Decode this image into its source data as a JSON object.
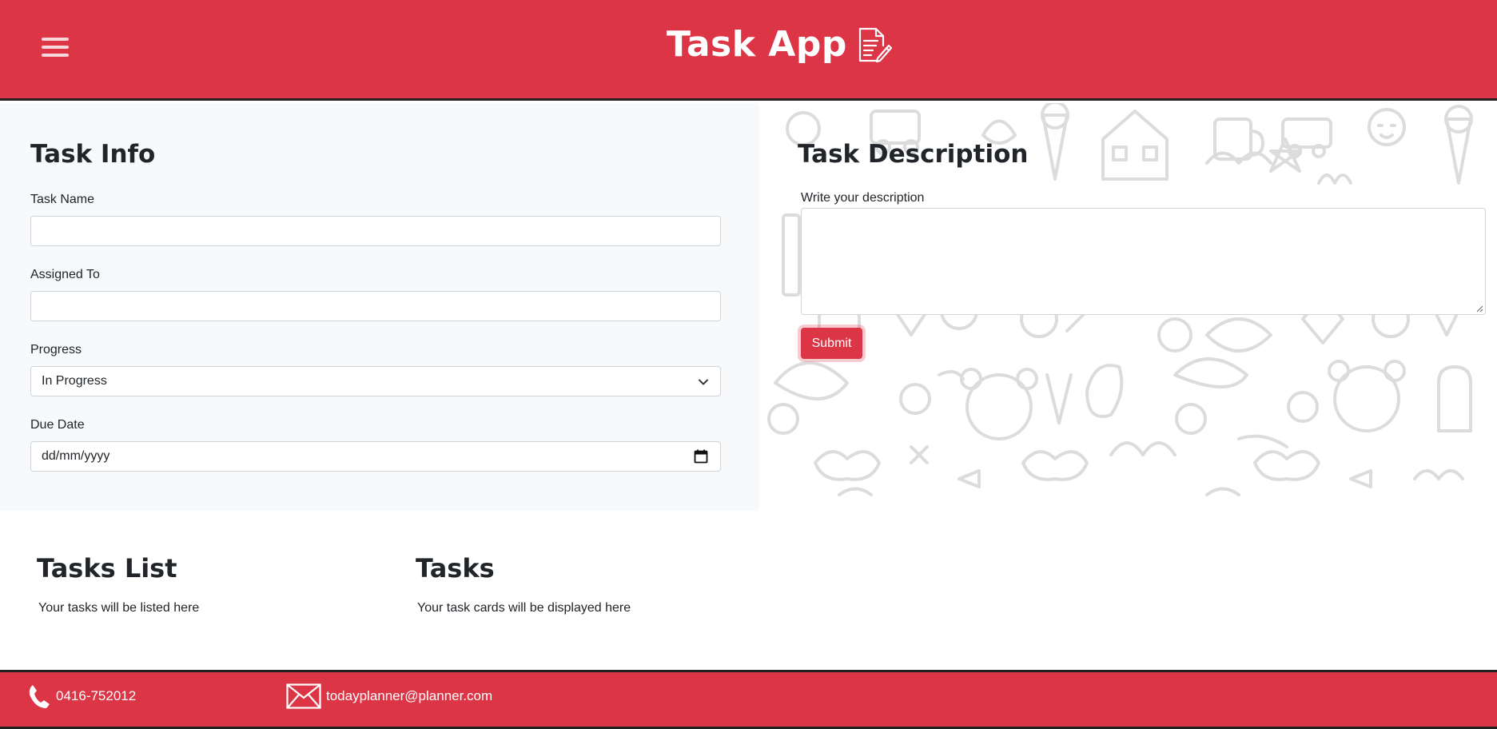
{
  "header": {
    "title": "Task App",
    "menu_icon": "hamburger-icon",
    "brand_icon": "document-edit-icon"
  },
  "task_info": {
    "heading": "Task Info",
    "task_name": {
      "label": "Task Name",
      "value": ""
    },
    "assigned_to": {
      "label": "Assigned To",
      "value": ""
    },
    "progress": {
      "label": "Progress",
      "value": "In Progress"
    },
    "due_date": {
      "label": "Due Date",
      "placeholder": "dd/mm/yyyy"
    }
  },
  "task_description": {
    "heading": "Task Description",
    "label": "Write your description",
    "value": "",
    "submit_label": "Submit"
  },
  "tasks_list": {
    "heading": "Tasks List",
    "text": "Your tasks will be listed here"
  },
  "tasks": {
    "heading": "Tasks",
    "text": "Your task cards will be displayed here"
  },
  "footer": {
    "phone": "0416-752012",
    "email": "todayplanner@planner.com"
  },
  "colors": {
    "brand": "#dc3545",
    "panel": "#f8f9fa",
    "border": "#ced4da"
  }
}
